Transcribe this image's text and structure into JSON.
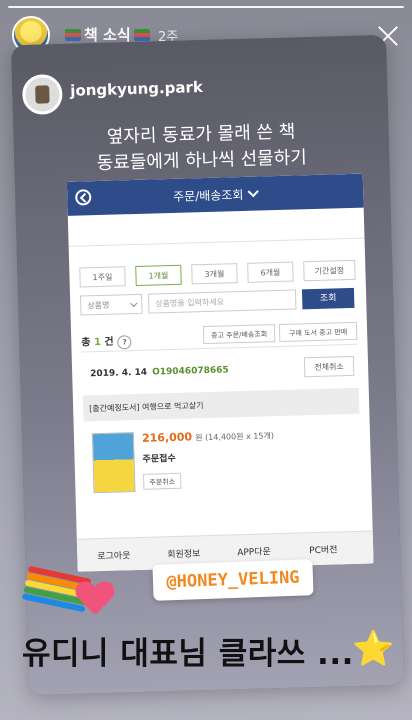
{
  "story": {
    "account_title": "책 소식",
    "time_ago": "2주"
  },
  "post": {
    "username": "jongkyung.park",
    "headline_line1": "옆자리 동료가 몰래 쓴 책",
    "headline_line2": "동료들에게 하나씩 선물하기"
  },
  "screenshot": {
    "header_title": "주문/배송조회",
    "periods": [
      "1주일",
      "1개월",
      "3개월",
      "6개월",
      "기간설정"
    ],
    "active_period_index": 1,
    "product_select": "상품명",
    "search_placeholder": "상품명을 입력하세요",
    "search_button": "조회",
    "total_prefix": "총",
    "total_count": "1",
    "total_suffix": "건",
    "help_icon": "?",
    "btn_cancel_return": "중고 주문/배송조회",
    "btn_sell_used": "구매 도서 중고 판매",
    "order_date": "2019. 4. 14",
    "order_number": "O19046078665",
    "cancel_all": "전체취소",
    "product_title": "[출간예정도서] 여행으로 먹고살기",
    "price": "216,000",
    "price_detail": "원 (14,400원 x 15개)",
    "order_status": "주문접수",
    "order_cancel": "주문취소",
    "footer": [
      "로그아웃",
      "회원정보",
      "APP다운",
      "PC버전"
    ]
  },
  "stickers": {
    "mention": "@HONEY_VELING",
    "caption": "유디니 대표님 클라쓰 ...",
    "star": "⭐"
  },
  "colors": {
    "header_blue": "#2f4c8a",
    "active_green": "#5c8e2c",
    "price_orange": "#e06a1a",
    "mention_orange": "#f08a1f"
  }
}
